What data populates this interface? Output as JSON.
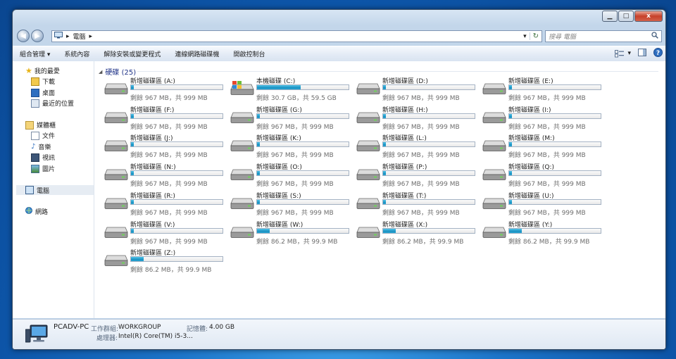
{
  "window": {
    "minimize": "▁",
    "maximize": "□",
    "close": "x"
  },
  "nav_buttons": {
    "back": "◀",
    "forward": "▶"
  },
  "address": {
    "root_arrow": "▸",
    "location": "電腦",
    "sep": "▸",
    "dropdown": "▾",
    "refresh": "↻"
  },
  "search": {
    "placeholder": "搜尋 電腦"
  },
  "toolbar": {
    "items": [
      "組合管理 ▾",
      "系統內容",
      "解除安裝或變更程式",
      "連線網路磁碟機",
      "開啟控制台"
    ],
    "view_arrow": "▾"
  },
  "sidebar": {
    "favorites": "我的最愛",
    "favorites_items": [
      "下載",
      "桌面",
      "最近的位置"
    ],
    "libraries": "媒體櫃",
    "libraries_items": [
      "文件",
      "音樂",
      "視訊",
      "圖片"
    ],
    "computer": "電腦",
    "network": "網路"
  },
  "group": {
    "title": "硬碟 (25)",
    "arrow": "◢"
  },
  "drives": [
    {
      "name": "新增磁碟區 (A:)",
      "free": "剩餘 967 MB，共 999 MB",
      "usage": 0.03,
      "system": false
    },
    {
      "name": "本機磁碟 (C:)",
      "free": "剩餘 30.7 GB，共 59.5 GB",
      "usage": 0.48,
      "system": true
    },
    {
      "name": "新增磁碟區 (D:)",
      "free": "剩餘 967 MB，共 999 MB",
      "usage": 0.03,
      "system": false
    },
    {
      "name": "新增磁碟區 (E:)",
      "free": "剩餘 967 MB，共 999 MB",
      "usage": 0.03,
      "system": false
    },
    {
      "name": "新增磁碟區 (F:)",
      "free": "剩餘 967 MB，共 999 MB",
      "usage": 0.03,
      "system": false
    },
    {
      "name": "新增磁碟區 (G:)",
      "free": "剩餘 967 MB，共 999 MB",
      "usage": 0.03,
      "system": false
    },
    {
      "name": "新增磁碟區 (H:)",
      "free": "剩餘 967 MB，共 999 MB",
      "usage": 0.03,
      "system": false
    },
    {
      "name": "新增磁碟區 (I:)",
      "free": "剩餘 967 MB，共 999 MB",
      "usage": 0.03,
      "system": false
    },
    {
      "name": "新增磁碟區 (J:)",
      "free": "剩餘 967 MB，共 999 MB",
      "usage": 0.03,
      "system": false
    },
    {
      "name": "新增磁碟區 (K:)",
      "free": "剩餘 967 MB，共 999 MB",
      "usage": 0.03,
      "system": false
    },
    {
      "name": "新增磁碟區 (L:)",
      "free": "剩餘 967 MB，共 999 MB",
      "usage": 0.03,
      "system": false
    },
    {
      "name": "新增磁碟區 (M:)",
      "free": "剩餘 967 MB，共 999 MB",
      "usage": 0.03,
      "system": false
    },
    {
      "name": "新增磁碟區 (N:)",
      "free": "剩餘 967 MB，共 999 MB",
      "usage": 0.03,
      "system": false
    },
    {
      "name": "新增磁碟區 (O:)",
      "free": "剩餘 967 MB，共 999 MB",
      "usage": 0.03,
      "system": false
    },
    {
      "name": "新增磁碟區 (P:)",
      "free": "剩餘 967 MB，共 999 MB",
      "usage": 0.03,
      "system": false
    },
    {
      "name": "新增磁碟區 (Q:)",
      "free": "剩餘 967 MB，共 999 MB",
      "usage": 0.03,
      "system": false
    },
    {
      "name": "新增磁碟區 (R:)",
      "free": "剩餘 967 MB，共 999 MB",
      "usage": 0.03,
      "system": false
    },
    {
      "name": "新增磁碟區 (S:)",
      "free": "剩餘 967 MB，共 999 MB",
      "usage": 0.03,
      "system": false
    },
    {
      "name": "新增磁碟區 (T:)",
      "free": "剩餘 967 MB，共 999 MB",
      "usage": 0.03,
      "system": false
    },
    {
      "name": "新增磁碟區 (U:)",
      "free": "剩餘 967 MB，共 999 MB",
      "usage": 0.03,
      "system": false
    },
    {
      "name": "新增磁碟區 (V:)",
      "free": "剩餘 967 MB，共 999 MB",
      "usage": 0.03,
      "system": false
    },
    {
      "name": "新增磁碟區 (W:)",
      "free": "剩餘 86.2 MB，共 99.9 MB",
      "usage": 0.14,
      "system": false
    },
    {
      "name": "新增磁碟區 (X:)",
      "free": "剩餘 86.2 MB，共 99.9 MB",
      "usage": 0.14,
      "system": false
    },
    {
      "name": "新增磁碟區 (Y:)",
      "free": "剩餘 86.2 MB，共 99.9 MB",
      "usage": 0.14,
      "system": false
    },
    {
      "name": "新增磁碟區 (Z:)",
      "free": "剩餘 86.2 MB，共 99.9 MB",
      "usage": 0.14,
      "system": false
    }
  ],
  "details": {
    "pc_name": "PCADV-PC",
    "workgroup_label": "工作群組:",
    "workgroup": "WORKGROUP",
    "memory_label": "記憶體:",
    "memory": "4.00 GB",
    "processor_label": "處理器:",
    "processor": "Intel(R) Core(TM) i5-3..."
  },
  "colors": {
    "accent": "#1b91c2",
    "window_frame": "#c3d6ea",
    "group_title": "#1e3287"
  }
}
